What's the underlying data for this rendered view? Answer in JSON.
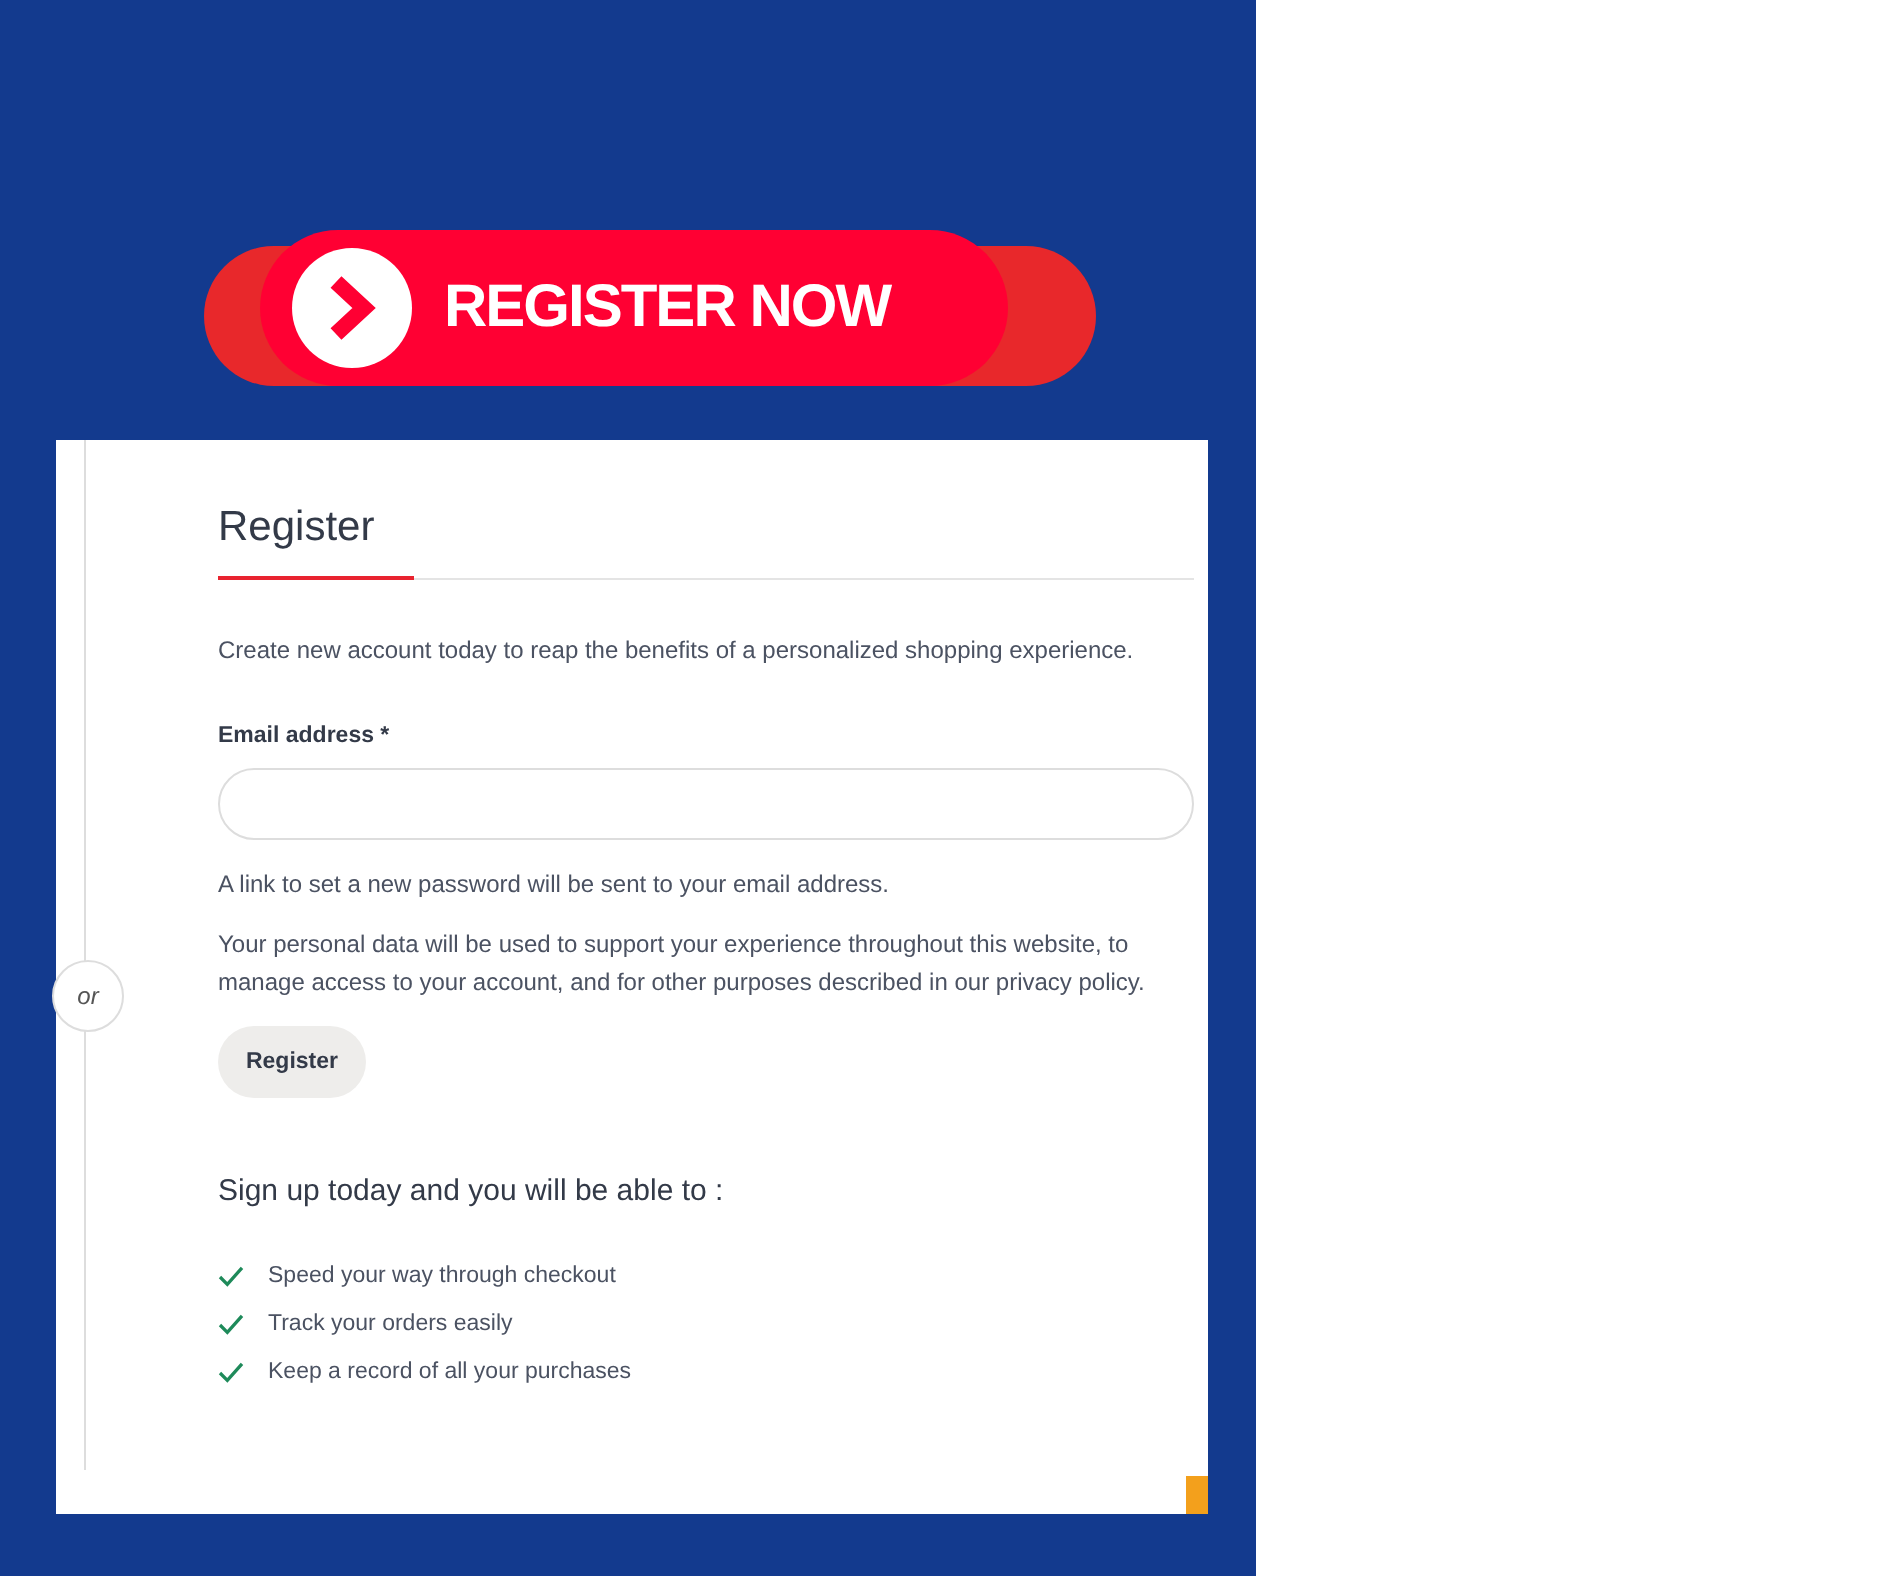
{
  "banner": {
    "label": "REGISTER NOW"
  },
  "form": {
    "title": "Register",
    "tab_selected": true,
    "intro": "Create new account today to reap the benefits of a personalized shopping experience.",
    "email_label": "Email address *",
    "hint": "A link to set a new password will be sent to your email address.",
    "privacy": "Your personal data will be used to support your experience throughout this website, to manage access to your account, and for other purposes described in our privacy policy.",
    "button": "Register",
    "divider_label": "or"
  },
  "benefits": {
    "heading": "Sign up today and you will be able to :",
    "items": [
      {
        "text": "Speed your way through checkout",
        "checked": true
      },
      {
        "text": "Track your orders easily",
        "checked": true
      },
      {
        "text": "Keep a record of all your purchases",
        "checked": true
      }
    ]
  }
}
